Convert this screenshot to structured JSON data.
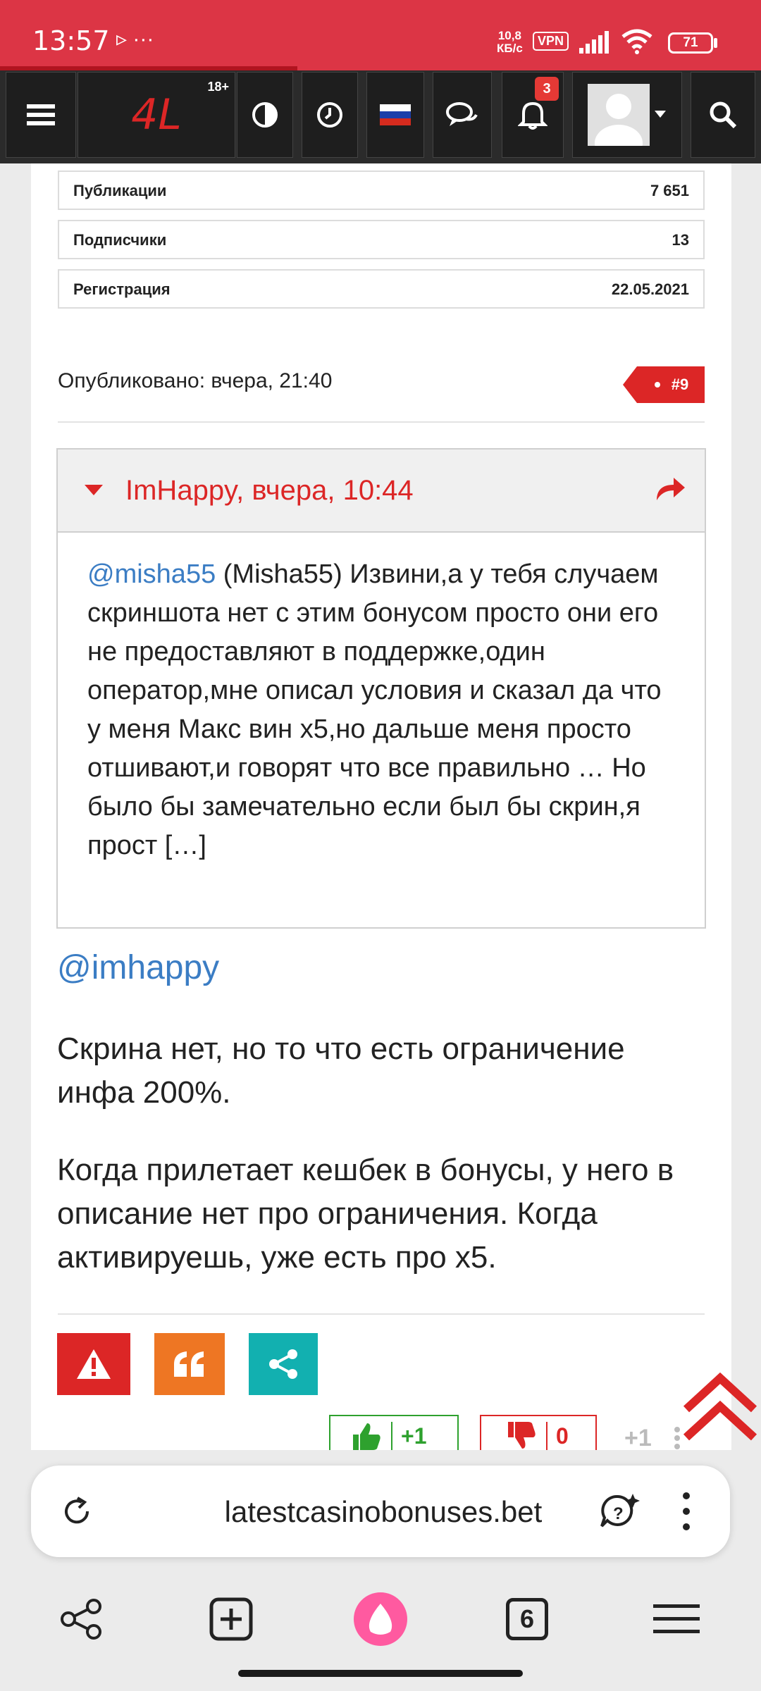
{
  "status_bar": {
    "time": "13:57",
    "icons": "▹ ···",
    "speed_value": "10,8",
    "speed_unit": "КБ/с",
    "vpn": "VPN",
    "battery": "71"
  },
  "header": {
    "logo": "4L",
    "age_label": "18+",
    "notification_count": "3"
  },
  "profile_stats": [
    {
      "label": "Публикации",
      "value": "7 651"
    },
    {
      "label": "Подписчики",
      "value": "13"
    },
    {
      "label": "Регистрация",
      "value": "22.05.2021"
    }
  ],
  "post": {
    "published": "Опубликовано: вчера, 21:40",
    "number": "#9",
    "quote": {
      "author": "ImHappy, вчера, 10:44",
      "mention": "@misha55",
      "text": " (Misha55) Извини,а у тебя слу­чаем скриншота нет с этим бонусом про­сто они его не предоставляют в поддержке,один оператор,мне описал условия и сказал да что у меня Макс вин х5,но дальше меня просто отшивают,и говорят что все правильно … Но было бы замечательно если был бы скрин,я прост […]"
    },
    "reply_mention": "@imhappy",
    "paragraph1": "Скрина нет, но то что есть ограниче­ние инфа 200%.",
    "paragraph2": "Когда прилетает кешбек в бонусы, у него в описание нет про ограничения. Когда активируешь, уже есть про х5.",
    "likes": "+1",
    "dislikes": "0",
    "score": "+1"
  },
  "browser": {
    "url": "latestcasinobonuses.bet",
    "tab_count": "6"
  },
  "colors": {
    "brand_red": "#dc2626",
    "report_red": "#dc2626",
    "quote_orange": "#ee7623",
    "share_teal": "#12b0b0",
    "like_green": "#2ea12e",
    "mention_blue": "#3b7dc4"
  }
}
